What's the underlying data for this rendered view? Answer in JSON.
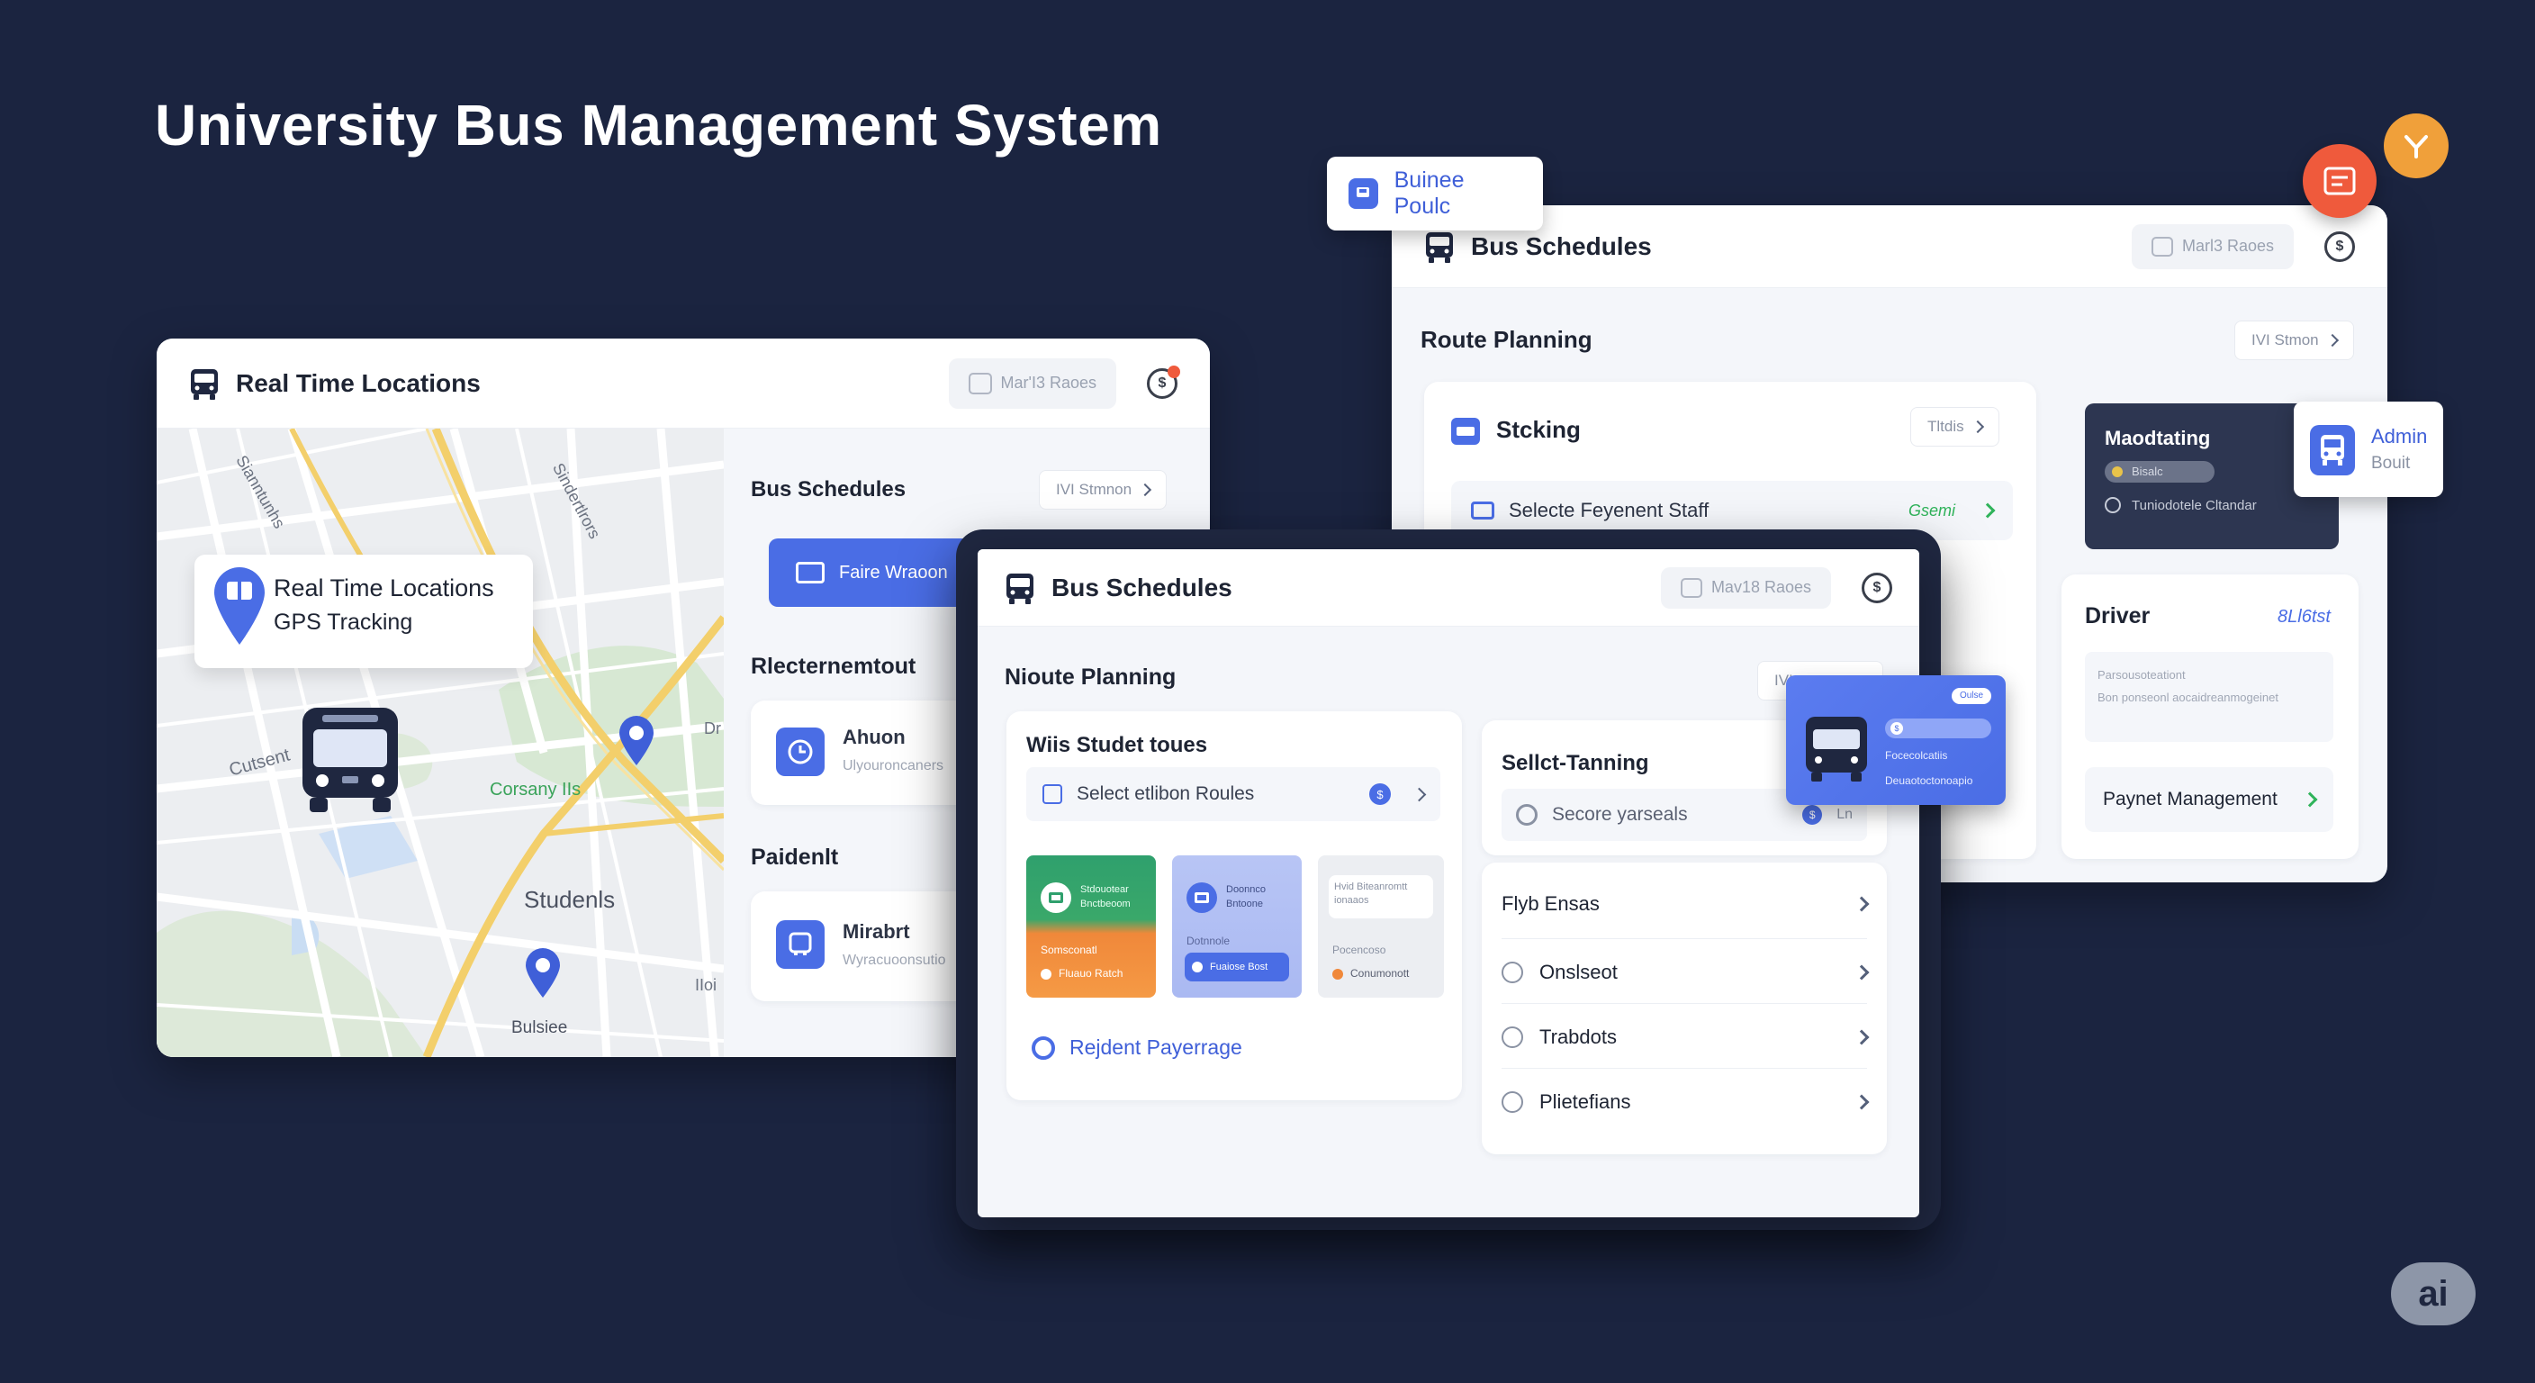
{
  "page_title": "University Bus Management System",
  "colors": {
    "bg": "#1b2440",
    "accent": "#4a6de5",
    "green": "#2fb35a",
    "orange": "#f0883a",
    "red": "#ef5a3c"
  },
  "map_card": {
    "title": "Real Time Locations",
    "pill": "Mar'I3 Raoes",
    "badge": "$",
    "callout_line1": "Real Time Locations",
    "callout_line2": "GPS Tracking",
    "map_labels": {
      "top_left": "Sianntunhs",
      "top_mid": "Sindertlrors",
      "left": "Cutsent",
      "park": "Corsany IIs",
      "students": "Studenls",
      "bottom": "Bulsiee",
      "right1": "Dr",
      "right2": "IIoi"
    },
    "side": {
      "title": "Bus Schedules",
      "btn": "IVI Stmnon",
      "blue_btn": "Faire Wraoon",
      "section1": "Rlecternemtout",
      "item1_title": "Ahuon",
      "item1_sub": "Ulyouroncaners",
      "section2": "Paidenlt",
      "item2_title": "Mirabrt",
      "item2_sub": "Wyracuoonsutio"
    }
  },
  "back_card": {
    "tag": "Buinee Poulc",
    "title": "Bus Schedules",
    "pill": "Marl3 Raoes",
    "badge": "$",
    "route_planning": "Route Planning",
    "route_btn": "IVI Stmon",
    "stocking": "Stcking",
    "stocking_btn": "Tltdis",
    "select_row": "Selecte Feyenent Staff",
    "select_tag": "Gsemi",
    "dark_title": "Maodtating",
    "dark_pill": "Bisalc",
    "dark_sub": "Tuniodotele Cltandar",
    "admin_line1": "Admin",
    "admin_line2": "Bouit",
    "driver": "Driver",
    "driver_tag": "8Ll6tst",
    "driver_line1": "Parsousoteationt",
    "driver_line2": "Bon ponseonl aocaidreanmogeinet",
    "payment": "Paynet Management"
  },
  "front_card": {
    "title": "Bus Schedules",
    "pill": "Mav18 Raoes",
    "badge": "$",
    "route_planning": "Nioute Planning",
    "route_btn": "IVI",
    "left": {
      "title": "Wiis Studet toues",
      "select": "Select etlibon Roules",
      "select_badge": "$",
      "tile1_title": "Stdouotear Bnctbeoom",
      "tile1_sub": "Somsconatl",
      "tile1_btn": "Fluauo Ratch",
      "tile2_title": "Doonnco Bntoone",
      "tile2_sub": "Dotnnole",
      "tile2_btn": "Fuaiose Bost",
      "tile3_title": "Hvid Biteanromtt ionaaos",
      "tile3_sub": "Pocencoso",
      "tile3_btn": "Conumonott",
      "footer": "Rejdent Payerrage"
    },
    "right": {
      "title": "Sellct-Tanning",
      "search": "Secore yarseals",
      "search_badge": "$",
      "search_tag": "Ln",
      "list_header": "Flyb Ensas",
      "items": [
        "Onslseot",
        "Trabdots",
        "Plietefians"
      ]
    },
    "overlay": {
      "toggle": "Oulse",
      "bar": "$",
      "line1": "Focecolcatiis",
      "line2": "Deuaotoctonoapio"
    }
  },
  "ai_badge": "ai"
}
